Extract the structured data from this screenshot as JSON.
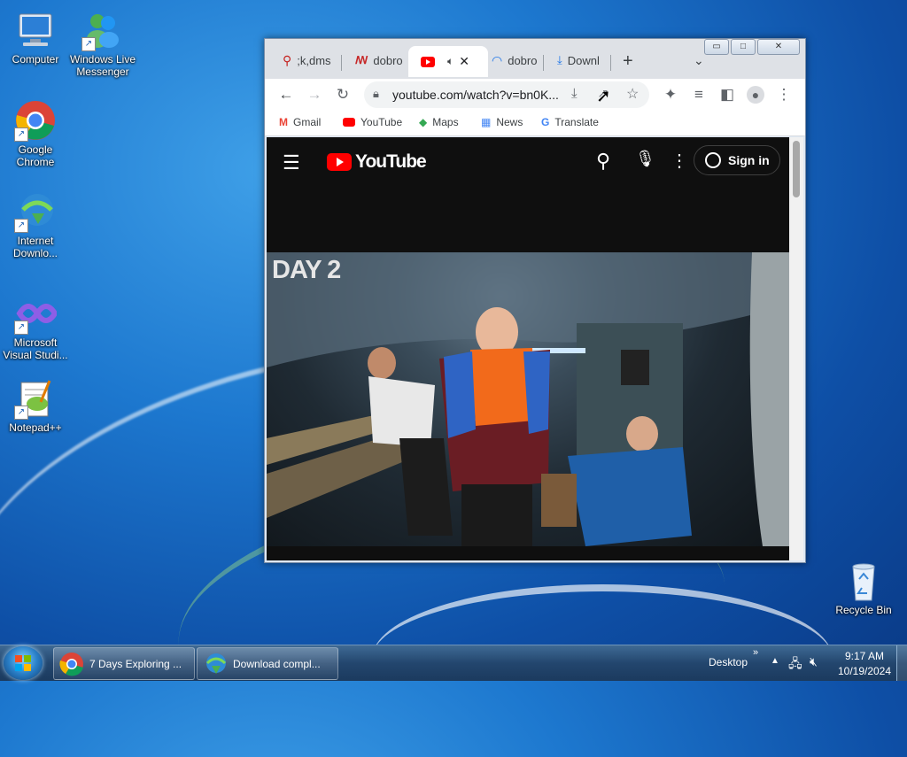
{
  "desktop": {
    "icons": [
      {
        "label": "Computer"
      },
      {
        "label": "Windows Live Messenger"
      },
      {
        "label": "Google Chrome"
      },
      {
        "label": "Internet Downlo..."
      },
      {
        "label": "Microsoft Visual Studi..."
      },
      {
        "label": "Notepad++"
      },
      {
        "label": "Recycle Bin"
      }
    ]
  },
  "browser": {
    "tabs": [
      {
        "label": ";k,dms",
        "icon": "search-icon"
      },
      {
        "label": "dobro",
        "icon": "site-icon"
      },
      {
        "label": "",
        "icon": "youtube-icon",
        "audio": "speaker-icon"
      },
      {
        "label": "dobro",
        "icon": "site-icon"
      },
      {
        "label": "Downl",
        "icon": "download-icon"
      }
    ],
    "window_buttons": {
      "minimize": "▭",
      "maximize": "□",
      "close": "✕"
    },
    "url": "youtube.com/watch?v=bn0K...",
    "bookmarks": [
      {
        "label": "Gmail",
        "color": "#ea4335"
      },
      {
        "label": "YouTube",
        "color": "#ff0000"
      },
      {
        "label": "Maps",
        "color": "#34a853"
      },
      {
        "label": "News",
        "color": "#4285f4"
      },
      {
        "label": "Translate",
        "color": "#4285f4"
      }
    ],
    "youtube": {
      "brand": "YouTube",
      "sign_in": "Sign in",
      "video_overlay": "DAY 2"
    }
  },
  "taskbar": {
    "items": [
      {
        "label": "7 Days Exploring ..."
      },
      {
        "label": "Download compl..."
      }
    ],
    "desktop_label": "Desktop",
    "time": "9:17 AM",
    "date": "10/19/2024"
  }
}
